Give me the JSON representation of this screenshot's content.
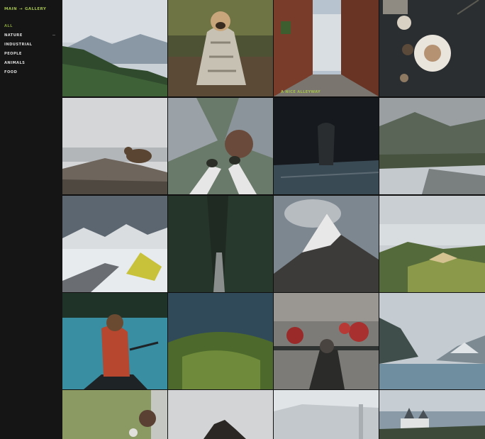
{
  "breadcrumb": {
    "main": "MAIN",
    "sep": "→",
    "current": "GALLERY"
  },
  "menu": [
    {
      "label": "ALL",
      "active": true
    },
    {
      "label": "NATURE",
      "active": false
    },
    {
      "label": "INDUSTRIAL",
      "active": false
    },
    {
      "label": "PEOPLE",
      "active": false
    },
    {
      "label": "ANIMALS",
      "active": false
    },
    {
      "label": "FOOD",
      "active": false
    }
  ],
  "photos": [
    {
      "subject": "mountain-forest-valley"
    },
    {
      "subject": "pug-in-blanket"
    },
    {
      "subject": "alleyway",
      "caption": "A NICE ALLEYWAY"
    },
    {
      "subject": "food-table-dark"
    },
    {
      "subject": "bear-on-rocks"
    },
    {
      "subject": "feet-over-city"
    },
    {
      "subject": "dark-rain-figure"
    },
    {
      "subject": "misty-river-valley"
    },
    {
      "subject": "snowy-tent"
    },
    {
      "subject": "forest-road"
    },
    {
      "subject": "matterhorn-peak"
    },
    {
      "subject": "green-hills-fog"
    },
    {
      "subject": "girl-in-canoe"
    },
    {
      "subject": "forest-aerial"
    },
    {
      "subject": "flowers-balcony"
    },
    {
      "subject": "lake-mountains"
    },
    {
      "subject": "grass-child"
    },
    {
      "subject": "rock-fog"
    },
    {
      "subject": "snowy-frost"
    },
    {
      "subject": "castle"
    }
  ]
}
